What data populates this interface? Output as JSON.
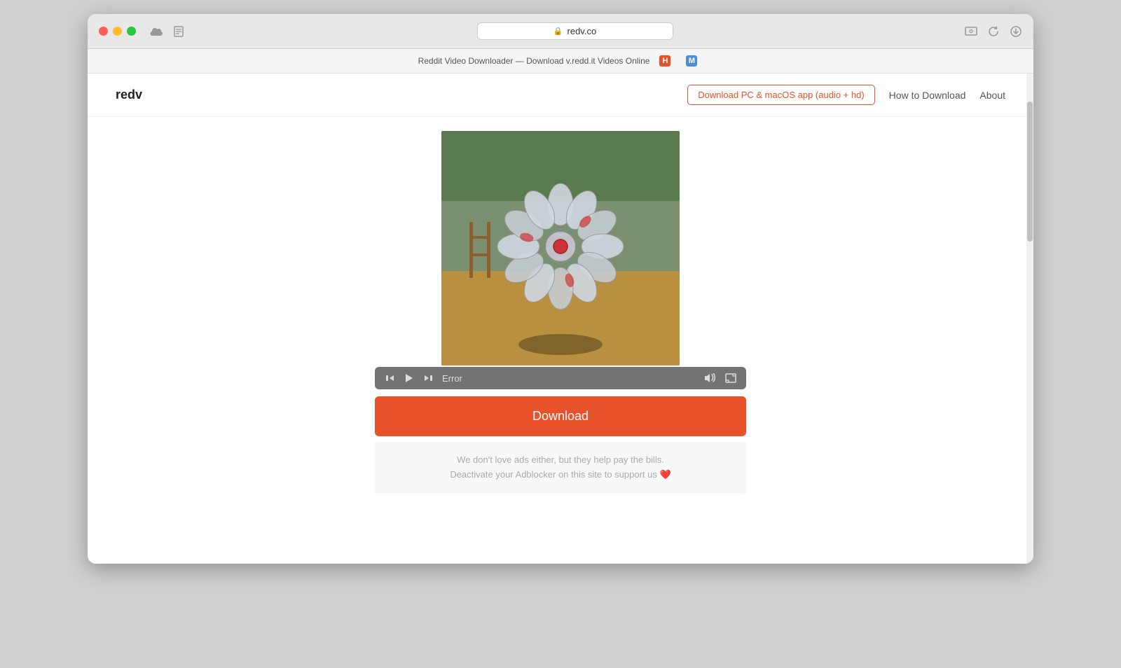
{
  "browser": {
    "url": "redv.co",
    "tab_title": "Reddit Video Downloader — Download v.redd.it Videos Online",
    "traffic_lights": [
      "red",
      "yellow",
      "green"
    ],
    "bookmark_icons": [
      {
        "id": "h-icon",
        "label": "H",
        "color": "icon-h"
      },
      {
        "id": "m-icon",
        "label": "M",
        "color": "icon-m"
      }
    ]
  },
  "nav": {
    "logo": "redv",
    "cta_button": "Download PC & macOS app (audio + hd)",
    "link_howto": "How to Download",
    "link_about": "About"
  },
  "video": {
    "status": "Error"
  },
  "controls": {
    "rewind_icon": "⟲",
    "play_icon": "▶",
    "forward_icon": "⟳",
    "volume_icon": "🔊",
    "fullscreen_icon": "⛶"
  },
  "download": {
    "button_label": "Download"
  },
  "adblocker": {
    "line1": "We don't love ads either, but they help pay the bills.",
    "line2": "Deactivate your Adblocker on this site to support us ❤️"
  }
}
